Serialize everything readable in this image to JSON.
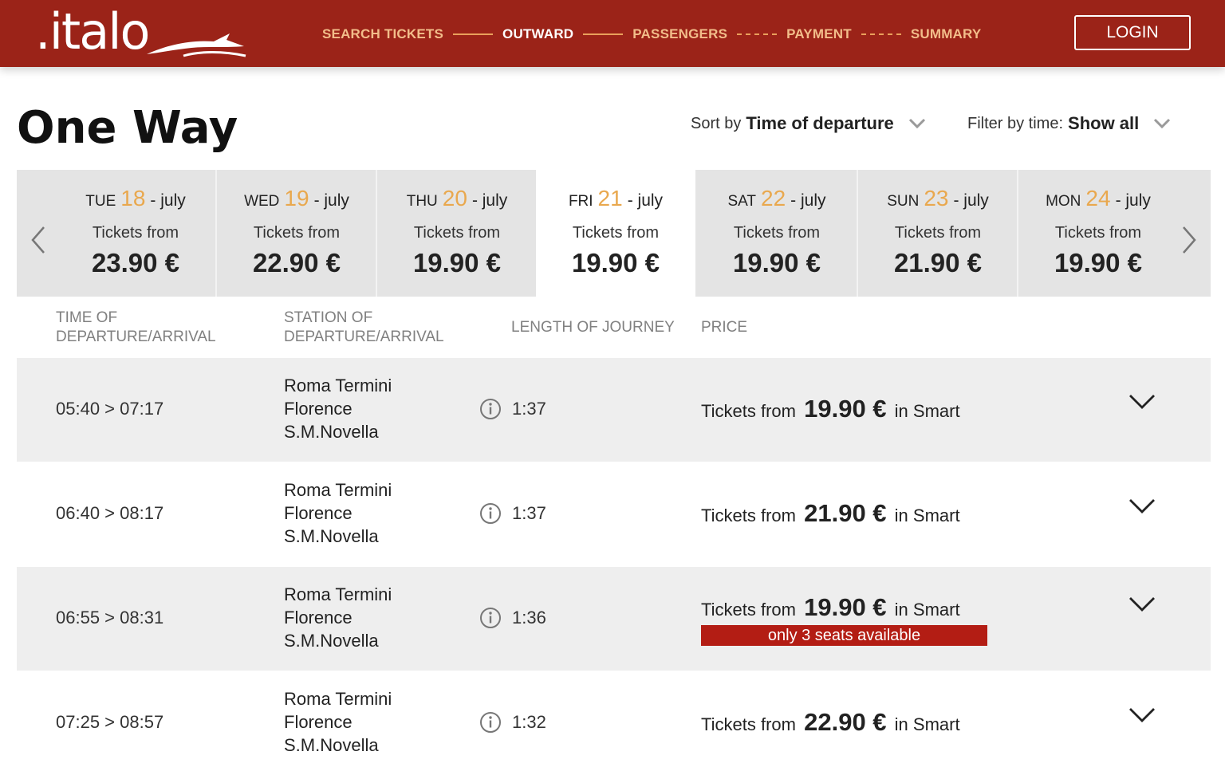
{
  "header": {
    "logo": ".italo",
    "steps": [
      {
        "label": "SEARCH TICKETS",
        "active": false
      },
      {
        "label": "OUTWARD",
        "active": true
      },
      {
        "label": "PASSENGERS",
        "active": false
      },
      {
        "label": "PAYMENT",
        "active": false
      },
      {
        "label": "SUMMARY",
        "active": false
      }
    ],
    "login_label": "LOGIN"
  },
  "page": {
    "title": "One Way",
    "sort_prefix": "Sort by",
    "sort_value": "Time of departure",
    "filter_prefix": "Filter by time:",
    "filter_value": "Show all"
  },
  "dates": [
    {
      "dow": "TUE",
      "num": "18",
      "month": "- july",
      "from_label": "Tickets from",
      "price": "23.90 €",
      "selected": false
    },
    {
      "dow": "WED",
      "num": "19",
      "month": "- july",
      "from_label": "Tickets from",
      "price": "22.90 €",
      "selected": false
    },
    {
      "dow": "THU",
      "num": "20",
      "month": "- july",
      "from_label": "Tickets from",
      "price": "19.90 €",
      "selected": false
    },
    {
      "dow": "FRI",
      "num": "21",
      "month": "- july",
      "from_label": "Tickets from",
      "price": "19.90 €",
      "selected": true
    },
    {
      "dow": "SAT",
      "num": "22",
      "month": "- july",
      "from_label": "Tickets from",
      "price": "19.90 €",
      "selected": false
    },
    {
      "dow": "SUN",
      "num": "23",
      "month": "- july",
      "from_label": "Tickets from",
      "price": "21.90 €",
      "selected": false
    },
    {
      "dow": "MON",
      "num": "24",
      "month": "- july",
      "from_label": "Tickets from",
      "price": "19.90 €",
      "selected": false
    }
  ],
  "columns": {
    "time_line1": "TIME OF",
    "time_line2": "DEPARTURE/ARRIVAL",
    "station_line1": "STATION OF",
    "station_line2": "DEPARTURE/ARRIVAL",
    "length": "LENGTH OF JOURNEY",
    "price": "PRICE"
  },
  "trains": [
    {
      "time": "05:40 > 07:17",
      "from": "Roma Termini",
      "to_line1": "Florence",
      "to_line2": "S.M.Novella",
      "duration": "1:37",
      "price_prefix": "Tickets from",
      "price": "19.90 €",
      "price_suffix": "in Smart",
      "badge": ""
    },
    {
      "time": "06:40 > 08:17",
      "from": "Roma Termini",
      "to_line1": "Florence",
      "to_line2": "S.M.Novella",
      "duration": "1:37",
      "price_prefix": "Tickets from",
      "price": "21.90 €",
      "price_suffix": "in Smart",
      "badge": ""
    },
    {
      "time": "06:55 > 08:31",
      "from": "Roma Termini",
      "to_line1": "Florence",
      "to_line2": "S.M.Novella",
      "duration": "1:36",
      "price_prefix": "Tickets from",
      "price": "19.90 €",
      "price_suffix": "in Smart",
      "badge": "only 3 seats available"
    },
    {
      "time": "07:25 > 08:57",
      "from": "Roma Termini",
      "to_line1": "Florence",
      "to_line2": "S.M.Novella",
      "duration": "1:32",
      "price_prefix": "Tickets from",
      "price": "22.90 €",
      "price_suffix": "in Smart",
      "badge": ""
    }
  ],
  "colors": {
    "brand": "#9b2318",
    "accent": "#e9a84e",
    "badge": "#b31d14"
  },
  "icons": [
    "hare-logo-icon",
    "chevron-down-icon",
    "chevron-left-icon",
    "chevron-right-icon",
    "info-icon",
    "expand-chevron-icon"
  ]
}
